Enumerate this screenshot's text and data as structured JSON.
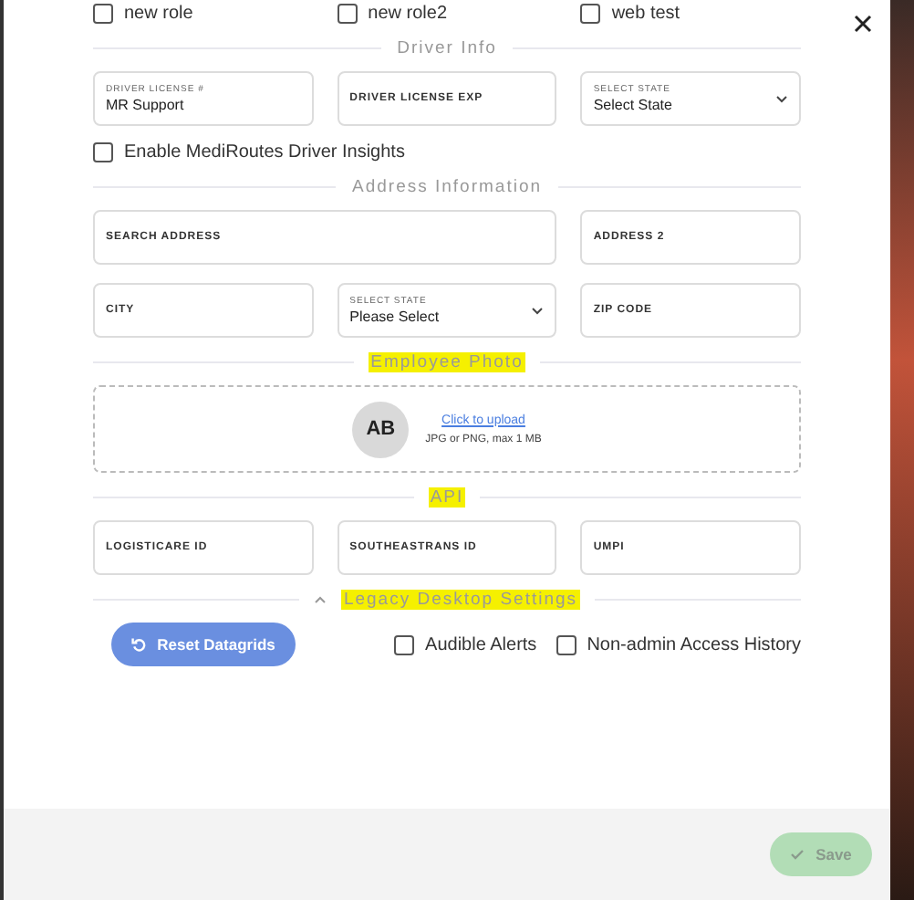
{
  "roles": [
    {
      "label": "new role",
      "checked": false
    },
    {
      "label": "new role2",
      "checked": false
    },
    {
      "label": "web test",
      "checked": false
    }
  ],
  "sections": [
    {
      "kind": "fields",
      "title": "Driver Info",
      "highlighted": false,
      "fields": [
        {
          "kind": "input",
          "label": "DRIVER LICENSE #",
          "value": "MR Support"
        },
        {
          "kind": "input",
          "label": "DRIVER LICENSE EXP"
        },
        {
          "kind": "select",
          "label": "SELECT STATE",
          "value": "Select State"
        }
      ],
      "checkbox": {
        "label": "Enable MediRoutes Driver Insights",
        "checked": false
      }
    },
    {
      "kind": "fields",
      "title": "Address Information",
      "highlighted": false,
      "fields": [
        {
          "kind": "input",
          "label": "SEARCH ADDRESS"
        },
        {
          "kind": "input",
          "label": "ADDRESS 2"
        },
        {
          "kind": "input",
          "label": "CITY"
        },
        {
          "kind": "select",
          "label": "SELECT STATE",
          "value": "Please Select"
        },
        {
          "kind": "input",
          "label": "ZIP CODE"
        }
      ]
    },
    {
      "kind": "photo",
      "title": "Employee Photo",
      "highlighted": true,
      "initials": "AB",
      "link": "Click to upload",
      "hint": "JPG or PNG, max 1 MB"
    },
    {
      "kind": "fields",
      "title": "API",
      "highlighted": true,
      "fields": [
        {
          "kind": "input",
          "label": "LOGISTICARE ID"
        },
        {
          "kind": "input",
          "label": "SOUTHEASTRANS ID"
        },
        {
          "kind": "input",
          "label": "UMPI"
        }
      ]
    },
    {
      "kind": "legacy",
      "title": "Legacy Desktop Settings",
      "highlighted": true,
      "expanded": true,
      "button": "Reset Datagrids",
      "options": [
        {
          "label": "Audible Alerts",
          "checked": false
        },
        {
          "label": "Non-admin Access History",
          "checked": false
        }
      ]
    }
  ],
  "save": {
    "label": "Save",
    "disabled": true
  }
}
